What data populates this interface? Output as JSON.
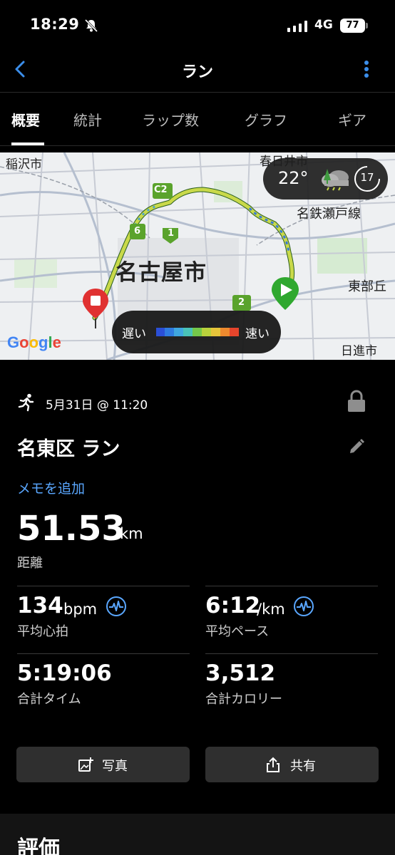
{
  "status": {
    "time": "18:29",
    "network": "4G",
    "battery": "77"
  },
  "nav": {
    "title": "ラン"
  },
  "tabs": [
    "概要",
    "統計",
    "ラップ数",
    "グラフ",
    "ギア"
  ],
  "map": {
    "labels": {
      "inazawa": "稲沢市",
      "kasugai": "春日井市",
      "meitetsu_seto": "名鉄瀬戸線",
      "nagoya": "名古屋市",
      "tobuokyu": "東部丘",
      "nisshin": "日進市"
    },
    "route_badges": {
      "c2": "C2",
      "six": "6",
      "one": "1",
      "two": "2"
    },
    "weather": {
      "temp": "22°",
      "timer": "17",
      "icon": "cloud-rain-icon"
    },
    "legend": {
      "slow": "遅い",
      "fast": "速い"
    },
    "attribution": "Google",
    "colors": {
      "route_main": "#c9d94a",
      "route_fast": "#3a7bd5",
      "start": "#2fa82f",
      "end": "#e03131"
    }
  },
  "activity": {
    "date": "5月31日 @ 11:20",
    "title": "名東区 ラン",
    "add_memo": "メモを追加",
    "distance": {
      "value": "51.53",
      "unit": "km",
      "label": "距離"
    },
    "heart_rate": {
      "value": "134",
      "unit": "bpm",
      "label": "平均心拍"
    },
    "pace": {
      "value": "6:12",
      "unit": "/km",
      "label": "平均ペース"
    },
    "total_time": {
      "value": "5:19:06",
      "label": "合計タイム"
    },
    "calories": {
      "value": "3,512",
      "label": "合計カロリー"
    }
  },
  "buttons": {
    "photo": "写真",
    "share": "共有"
  },
  "rating": {
    "title": "評価"
  },
  "accent_color": "#5aa7ff"
}
